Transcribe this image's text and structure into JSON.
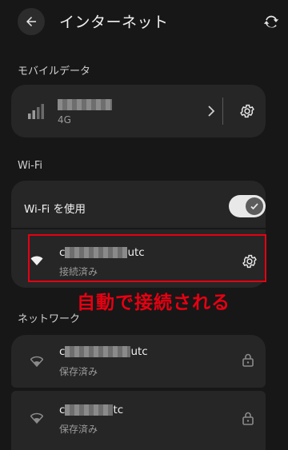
{
  "header": {
    "title": "インターネット",
    "back_icon": "arrow-left-icon",
    "reset_icon": "network-reset-icon"
  },
  "mobile_data": {
    "section_label": "モバイルデータ",
    "carrier_name": "",
    "network_type": "4G",
    "signal_icon": "signal-bars-icon",
    "settings_icon": "gear-icon"
  },
  "wifi": {
    "section_label": "Wi-Fi",
    "use_wifi_label": "Wi-Fi を使用",
    "toggle_on": true,
    "connected_network": {
      "name_prefix": "c",
      "name_suffix": "utc",
      "status": "接続済み"
    }
  },
  "annotation": {
    "text": "自動で接続される",
    "color": "#e60012"
  },
  "networks": {
    "section_label": "ネットワーク",
    "items": [
      {
        "name_prefix": "c",
        "name_suffix": "utc",
        "status": "保存済み"
      },
      {
        "name_prefix": "c",
        "name_suffix": "tc",
        "status": "保存済み"
      }
    ]
  }
}
